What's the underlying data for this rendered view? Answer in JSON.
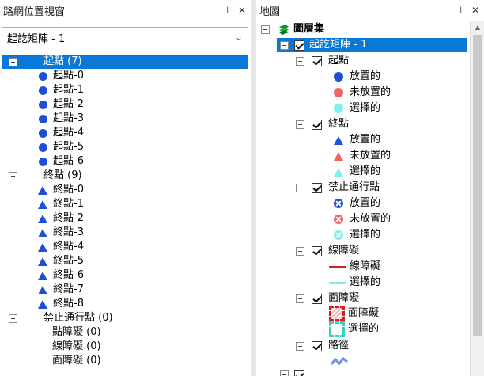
{
  "left_panel": {
    "title": "路網位置視窗",
    "pin_icon": "pin-icon",
    "close_icon": "close-icon",
    "combo_value": "起訖矩陣 - 1",
    "tree": {
      "origins": {
        "label": "起點 (7)",
        "items": [
          "起點-0",
          "起點-1",
          "起點-2",
          "起點-3",
          "起點-4",
          "起點-5",
          "起點-6"
        ]
      },
      "destinations": {
        "label": "終點 (9)",
        "items": [
          "終點-0",
          "終點-1",
          "終點-2",
          "終點-3",
          "終點-4",
          "終點-5",
          "終點-6",
          "終點-7",
          "終點-8"
        ]
      },
      "restrictions": {
        "label": "禁止通行點 (0)"
      },
      "line_barriers": "點障礙 (0)",
      "polyline_barriers": "線障礙 (0)",
      "polygon_barriers": "面障礙 (0)"
    }
  },
  "right_panel": {
    "title": "地圖",
    "layers_root": "圖層集",
    "od_layer": "起訖矩陣 - 1",
    "origins": {
      "label": "起點",
      "located": "放置的",
      "unlocated": "未放置的",
      "selected": "選擇的"
    },
    "destinations": {
      "label": "終點",
      "located": "放置的",
      "unlocated": "未放置的",
      "selected": "選擇的"
    },
    "restrictions": {
      "label": "禁止通行點",
      "located": "放置的",
      "unlocated": "未放置的",
      "selected": "選擇的"
    },
    "line_barriers": {
      "label": "線障礙",
      "item": "線障礙",
      "selected": "選擇的"
    },
    "polygon_barriers": {
      "label": "面障礙",
      "item": "面障礙",
      "selected": "選擇的"
    },
    "routes": {
      "label": "路徑"
    }
  },
  "colors": {
    "selection": "#0a78d7",
    "located_blue": "#1f4fd6",
    "unlocated_red": "#f26464",
    "selected_cyan": "#7ff0f0",
    "barrier_red": "#d62020",
    "route_blue": "#6a8fe8"
  }
}
